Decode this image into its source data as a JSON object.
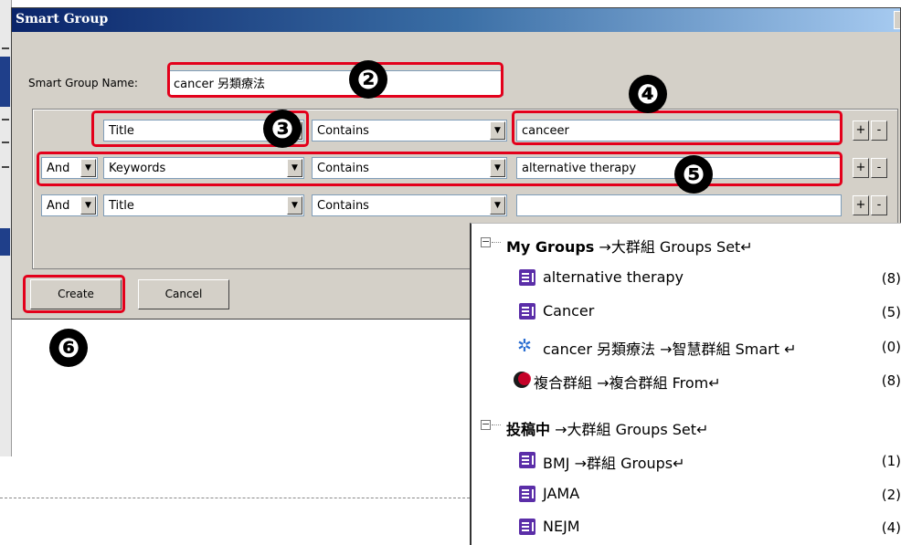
{
  "dialog": {
    "title": "Smart Group",
    "name_label": "Smart Group Name:",
    "name_value": "cancer 另類療法",
    "rows": [
      {
        "bool": "",
        "field": "Title",
        "op": "Contains",
        "value": "canceer"
      },
      {
        "bool": "And",
        "field": "Keywords",
        "op": "Contains",
        "value": "alternative therapy"
      },
      {
        "bool": "And",
        "field": "Title",
        "op": "Contains",
        "value": ""
      }
    ],
    "plus": "+",
    "minus": "-",
    "create_label": "Create",
    "cancel_label": "Cancel"
  },
  "annotations": {
    "n2": "❷",
    "n3": "❸",
    "n4": "❹",
    "n5": "❺",
    "n6": "❻"
  },
  "tree": {
    "g1": {
      "title": "My Groups",
      "note": "→大群組 Groups Set↵"
    },
    "items1": [
      {
        "name": "alternative therapy",
        "count": "(8)"
      },
      {
        "name": "Cancer",
        "count": "(5)"
      },
      {
        "name": "cancer 另類療法 →智慧群組 Smart ↵",
        "count": "(0)"
      },
      {
        "name": "複合群組 →複合群組 From↵",
        "count": "(8)"
      }
    ],
    "g2": {
      "title": "投稿中",
      "note": "→大群組 Groups Set↵"
    },
    "items2": [
      {
        "name": "BMJ →群組 Groups↵",
        "count": "(1)"
      },
      {
        "name": "JAMA",
        "count": "(2)"
      },
      {
        "name": "NEJM",
        "count": "(4)"
      }
    ]
  }
}
